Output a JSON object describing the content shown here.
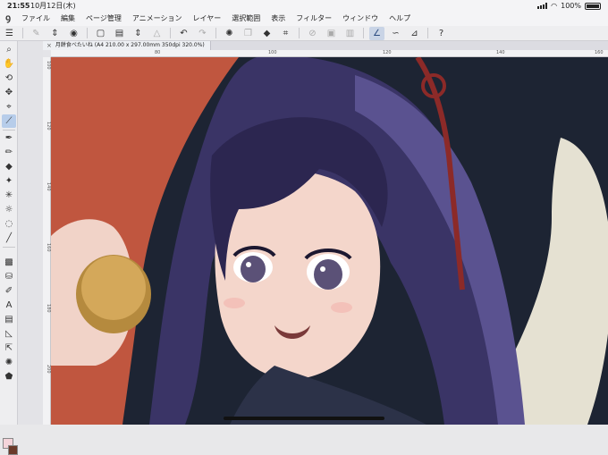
{
  "status": {
    "time": "21:55",
    "date": "10月12日(木)",
    "battery": "100%"
  },
  "menu": [
    "ファイル",
    "編集",
    "ページ管理",
    "アニメーション",
    "レイヤー",
    "選択範囲",
    "表示",
    "フィルター",
    "ウィンドウ",
    "ヘルプ"
  ],
  "document": {
    "tab_title": "月餅食べたいね (A4 210.00 x 297.00mm 350dpi 320.0%)"
  },
  "ruler": {
    "top": [
      "80",
      "100",
      "120",
      "140",
      "160"
    ],
    "left": [
      "100",
      "120",
      "140",
      "160",
      "180",
      "200"
    ]
  },
  "colors": {
    "main_color": "#f4d4da",
    "sub_color": "#6a3a2a",
    "accent": "#2a4a80",
    "canvas_background": "#1d2433",
    "red_background": "#c0563f"
  },
  "toolbar_icons": [
    "menu-icon",
    "stamp-icon",
    "arrow-updown-icon",
    "target-icon",
    "new-file-icon",
    "save-icon",
    "arrow-updown-icon",
    "triangle-icon",
    "undo-icon",
    "redo-icon",
    "spinner-icon",
    "copy-icon",
    "fill-icon",
    "crop-icon",
    "hide-icon",
    "transform-icon",
    "layer-icon",
    "stabilizer-icon",
    "smoothing-icon",
    "correction-icon",
    "help-icon"
  ],
  "tool_icons": [
    "zoom-icon",
    "hand-icon",
    "rotate-icon",
    "move-icon",
    "lasso-icon",
    "eyedropper-icon",
    "pen-icon",
    "pencil-icon",
    "eraser-icon",
    "blend-icon",
    "decoration-icon",
    "sparkle-icon",
    "selection-icon",
    "line-icon",
    "gradient-icon",
    "fill-bucket-icon",
    "vector-icon",
    "text-icon",
    "frame-icon",
    "ruler-icon",
    "object-icon",
    "effect-icon",
    "color-icon"
  ]
}
